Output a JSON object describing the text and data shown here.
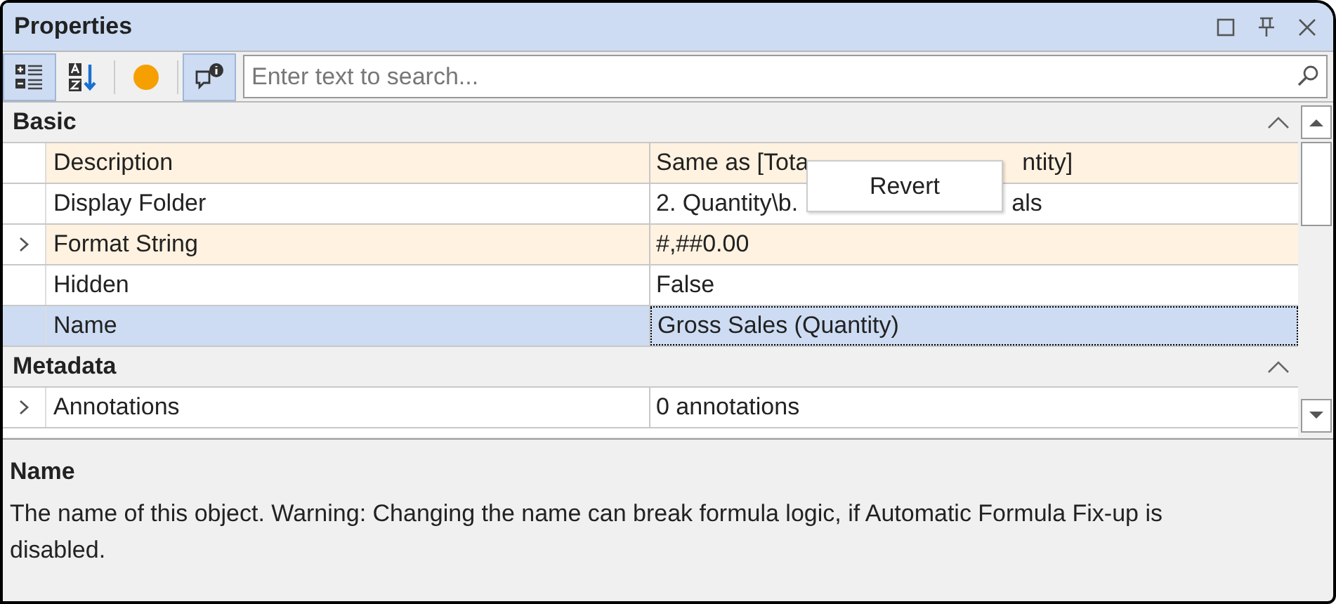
{
  "window": {
    "title": "Properties"
  },
  "toolbar": [
    {
      "kind": "categorized",
      "selected": true
    },
    {
      "kind": "alphabetical",
      "selected": false
    },
    {
      "kind": "dot",
      "selected": false
    },
    {
      "kind": "comments",
      "selected": true
    }
  ],
  "search": {
    "placeholder": "Enter text to search..."
  },
  "categories": [
    {
      "name": "Basic",
      "expanded": true,
      "rows": [
        {
          "name": "Description",
          "value_parts": [
            "Same as [Tota",
            "ntity]"
          ],
          "modified": true,
          "selected": false,
          "expandable": false
        },
        {
          "name": "Display Folder",
          "value_parts": [
            "2. Quantity\\b.",
            "als"
          ],
          "modified": false,
          "selected": false,
          "expandable": false
        },
        {
          "name": "Format String",
          "value_parts": [
            "#,##0.00"
          ],
          "modified": true,
          "selected": false,
          "expandable": true
        },
        {
          "name": "Hidden",
          "value_parts": [
            "False"
          ],
          "modified": false,
          "selected": false,
          "expandable": false
        },
        {
          "name": "Name",
          "value_parts": [
            "Gross Sales (Quantity)"
          ],
          "modified": false,
          "selected": true,
          "expandable": false
        }
      ]
    },
    {
      "name": "Metadata",
      "expanded": true,
      "rows": [
        {
          "name": "Annotations",
          "value_parts": [
            "0 annotations"
          ],
          "modified": false,
          "selected": false,
          "expandable": true
        }
      ]
    }
  ],
  "popup": {
    "label": "Revert"
  },
  "help": {
    "title": "Name",
    "text": "The name of this object. Warning: Changing the name can break formula logic, if Automatic Formula Fix-up is disabled."
  }
}
